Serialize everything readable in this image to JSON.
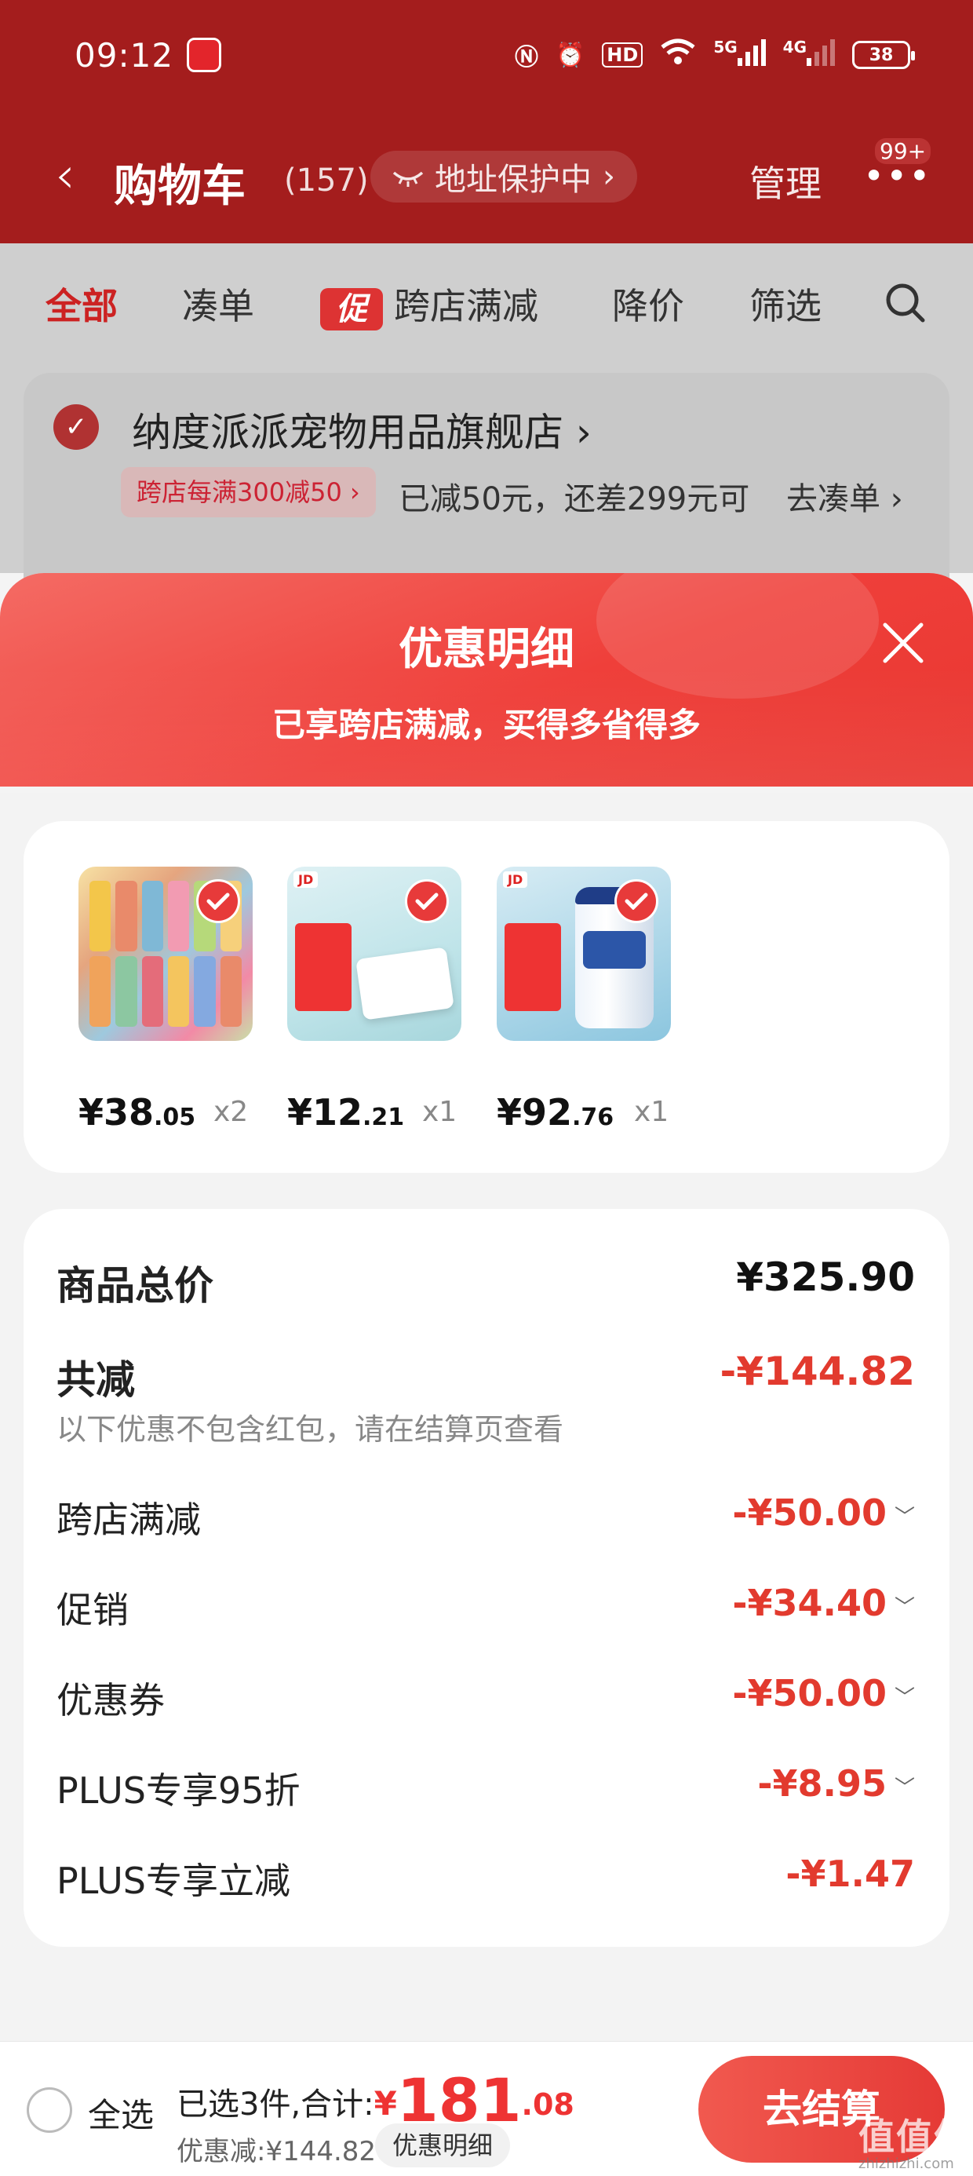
{
  "status": {
    "time": "09:12",
    "network1": "5G",
    "network2": "4G",
    "battery": "38"
  },
  "header": {
    "back": "‹",
    "title": "购物车",
    "count": "(157)",
    "address": "地址保护中",
    "manage": "管理",
    "msg_badge": "99+"
  },
  "tabs": [
    {
      "label": "全部"
    },
    {
      "label": "凑单"
    },
    {
      "label": "跨店满减",
      "promo_icon": "促"
    },
    {
      "label": "降价"
    },
    {
      "label": "筛选"
    }
  ],
  "shop": {
    "name": "纳度派派宠物用品旗舰店",
    "promo": "跨店每满300减50",
    "promo_text": "已减50元，还差299元可",
    "go": "去凑单"
  },
  "modal": {
    "title": "优惠明细",
    "subtitle": "已享跨店满减，买得多省得多",
    "products": [
      {
        "price_int": "¥38",
        "price_dec": ".05",
        "qty": "x2"
      },
      {
        "price_int": "¥12",
        "price_dec": ".21",
        "qty": "x1"
      },
      {
        "price_int": "¥92",
        "price_dec": ".76",
        "qty": "x1"
      }
    ],
    "summary": {
      "total_label": "商品总价",
      "total_value": "¥325.90",
      "reduce_label": "共减",
      "reduce_value": "-¥144.82",
      "note": "以下优惠不包含红包，请在结算页查看",
      "rows": [
        {
          "label": "跨店满减",
          "value": "-¥50.00"
        },
        {
          "label": "促销",
          "value": "-¥34.40"
        },
        {
          "label": "优惠券",
          "value": "-¥50.00"
        },
        {
          "label": "PLUS专享95折",
          "value": "-¥8.95"
        },
        {
          "label": "PLUS专享立减",
          "value": "-¥1.47"
        }
      ]
    }
  },
  "bottom": {
    "select_all": "全选",
    "selected_text": "已选3件,合计:",
    "currency": "¥",
    "total_int": "181",
    "total_dec": ".08",
    "discount": "优惠减:¥144.82",
    "discount_btn": "优惠明细",
    "checkout": "去结算",
    "watermark": "值值值",
    "watermark_url": "zhizhizhi.com"
  },
  "colors": {
    "header_bg": "#a41d1d",
    "accent": "#e23a2e",
    "modal_head": "#ef3f3a"
  }
}
